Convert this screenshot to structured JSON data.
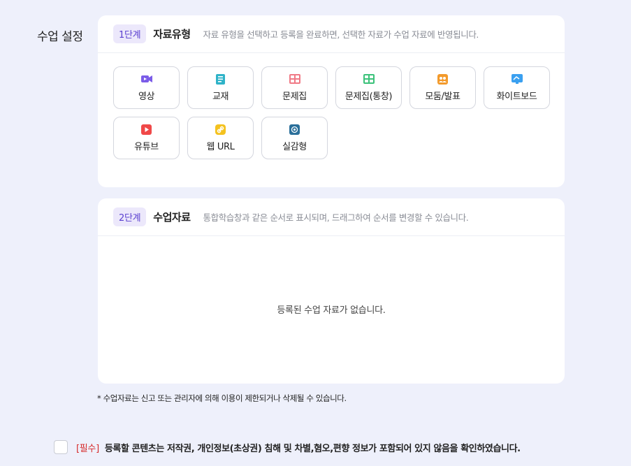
{
  "section_label": "수업 설정",
  "step1": {
    "badge": "1단계",
    "title": "자료유형",
    "desc": "자료 유형을 선택하고 등록을 완료하면, 선택한 자료가 수업 자료에 반영됩니다."
  },
  "types": [
    {
      "label": "영상",
      "icon": "video-icon",
      "color": "#7b5ce8"
    },
    {
      "label": "교재",
      "icon": "book-icon",
      "color": "#2fb3c8"
    },
    {
      "label": "문제집",
      "icon": "quiz-icon",
      "color": "#f07a86"
    },
    {
      "label": "문제집(통창)",
      "icon": "quiz-window-icon",
      "color": "#3cc27a"
    },
    {
      "label": "모둠/발표",
      "icon": "group-icon",
      "color": "#f39a2b"
    },
    {
      "label": "화이트보드",
      "icon": "whiteboard-icon",
      "color": "#3aa0f0"
    },
    {
      "label": "유튜브",
      "icon": "youtube-icon",
      "color": "#f04848"
    },
    {
      "label": "웹 URL",
      "icon": "link-icon",
      "color": "#f4c21f"
    },
    {
      "label": "실감형",
      "icon": "immersive-icon",
      "color": "#2a6f9a"
    }
  ],
  "step2": {
    "badge": "2단계",
    "title": "수업자료",
    "desc": "통합학습창과 같은 순서로 표시되며, 드래그하여 순서를 변경할 수 있습니다.",
    "empty": "등록된 수업 자료가 없습니다."
  },
  "notice": "* 수업자료는 신고 또는 관리자에 의해 이용이 제한되거나 삭제될 수 있습니다.",
  "agreement": {
    "required": "[필수]",
    "text": "등록할 콘텐츠는 저작권, 개인정보(초상권) 침해 및 차별,혐오,편향 정보가 포함되어 있지 않음을 확인하였습니다."
  }
}
